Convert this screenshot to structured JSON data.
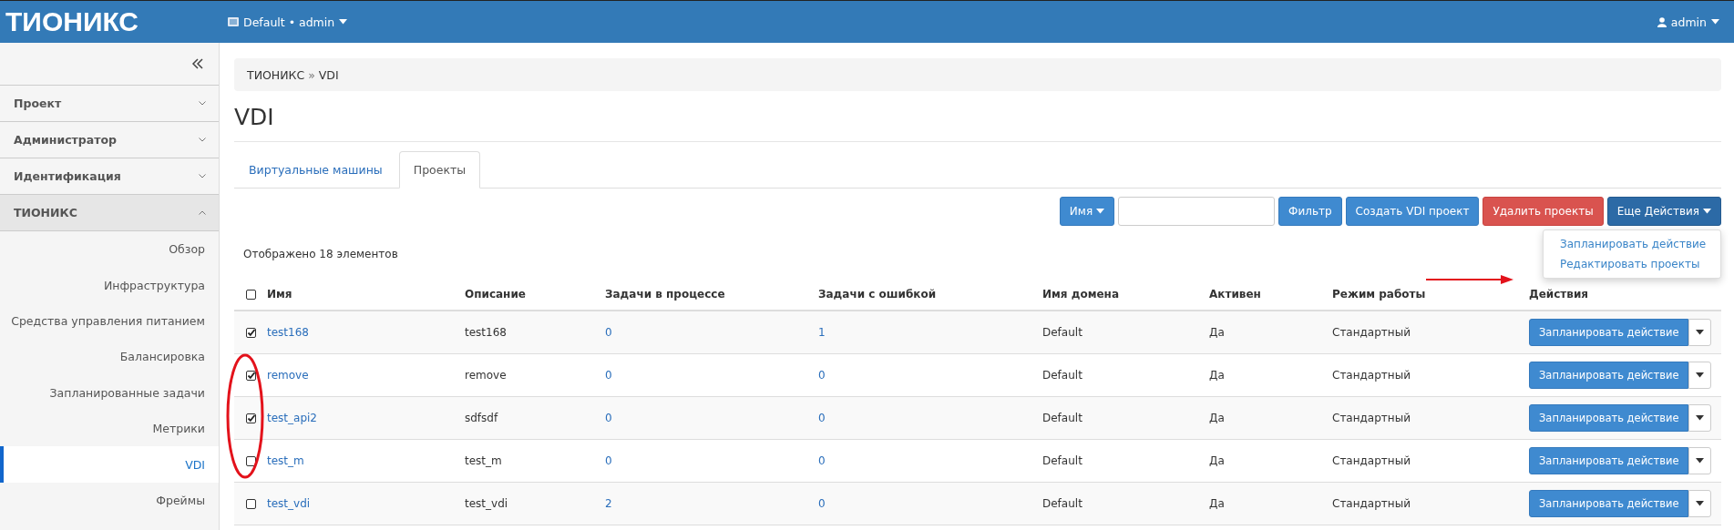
{
  "topbar": {
    "logo": "ТИОНИКС",
    "project_menu": "Default • admin",
    "user_menu": "admin"
  },
  "sidebar": {
    "sections": [
      {
        "label": "Проект",
        "expanded": false
      },
      {
        "label": "Администратор",
        "expanded": false
      },
      {
        "label": "Идентификация",
        "expanded": false
      },
      {
        "label": "ТИОНИКС",
        "expanded": true,
        "children": [
          {
            "label": "Обзор",
            "selected": false
          },
          {
            "label": "Инфраструктура",
            "selected": false
          },
          {
            "label": "Средства управления питанием",
            "selected": false
          },
          {
            "label": "Балансировка",
            "selected": false
          },
          {
            "label": "Запланированные задачи",
            "selected": false
          },
          {
            "label": "Метрики",
            "selected": false
          },
          {
            "label": "VDI",
            "selected": true
          },
          {
            "label": "Фреймы",
            "selected": false
          }
        ]
      }
    ]
  },
  "breadcrumb": {
    "items": [
      "ТИОНИКС",
      "VDI"
    ],
    "separator": "»"
  },
  "page_title": "VDI",
  "tabs": [
    {
      "label": "Виртуальные машины",
      "selected": false
    },
    {
      "label": "Проекты",
      "selected": true
    }
  ],
  "toolbar": {
    "filter_select": "Имя",
    "buttons": [
      {
        "label": "Фильтр",
        "kind": "primary"
      },
      {
        "label": "Создать VDI проект",
        "kind": "primary"
      },
      {
        "label": "Удалить проекты",
        "kind": "danger"
      },
      {
        "label": "Еще Действия",
        "kind": "menu"
      }
    ]
  },
  "dropdown_menu": [
    "Запланировать действие",
    "Редактировать проекты"
  ],
  "count_text": "Отображено 18 элементов",
  "table": {
    "select_all_checked": false,
    "columns": [
      {
        "label": "Имя",
        "kind": "link"
      },
      {
        "label": "Описание",
        "kind": "text"
      },
      {
        "label": "Задачи в процессе",
        "kind": "link"
      },
      {
        "label": "Задачи с ошибкой",
        "kind": "link"
      },
      {
        "label": "Имя домена",
        "kind": "text"
      },
      {
        "label": "Активен",
        "kind": "text"
      },
      {
        "label": "Режим работы",
        "kind": "text"
      },
      {
        "label": "Действия",
        "kind": "action"
      }
    ],
    "rows": [
      {
        "checked": true,
        "cells": [
          "test168",
          "test168",
          "0",
          "1",
          "Default",
          "Да",
          "Стандартный",
          "Запланировать действие"
        ]
      },
      {
        "checked": true,
        "cells": [
          "remove",
          "remove",
          "0",
          "0",
          "Default",
          "Да",
          "Стандартный",
          "Запланировать действие"
        ]
      },
      {
        "checked": true,
        "cells": [
          "test_api2",
          "sdfsdf",
          "0",
          "0",
          "Default",
          "Да",
          "Стандартный",
          "Запланировать действие"
        ]
      },
      {
        "checked": false,
        "cells": [
          "test_m",
          "test_m",
          "0",
          "0",
          "Default",
          "Да",
          "Стандартный",
          "Запланировать действие"
        ]
      },
      {
        "checked": false,
        "cells": [
          "test_vdi",
          "test_vdi",
          "2",
          "0",
          "Default",
          "Да",
          "Стандартный",
          "Запланировать действие"
        ]
      }
    ]
  }
}
